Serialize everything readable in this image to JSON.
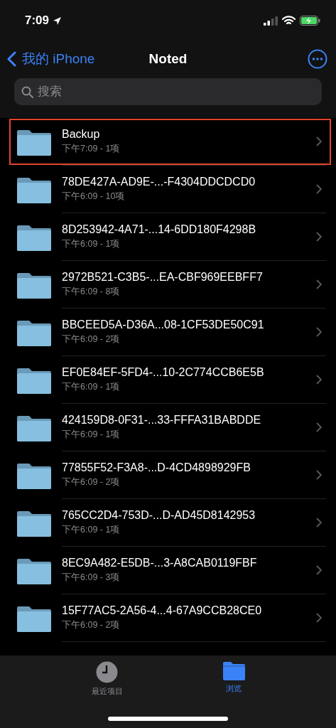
{
  "status_bar": {
    "time": "7:09"
  },
  "nav": {
    "back_label": "我的 iPhone",
    "title": "Noted"
  },
  "search": {
    "placeholder": "搜索"
  },
  "folders": [
    {
      "name": "Backup",
      "meta": "下午7:09 - 1项",
      "highlighted": true
    },
    {
      "name": "78DE427A-AD9E-...-F4304DDCDCD0",
      "meta": "下午6:09 - 10项",
      "highlighted": false
    },
    {
      "name": "8D253942-4A71-...14-6DD180F4298B",
      "meta": "下午6:09 - 1项",
      "highlighted": false
    },
    {
      "name": "2972B521-C3B5-...EA-CBF969EEBFF7",
      "meta": "下午6:09 - 8项",
      "highlighted": false
    },
    {
      "name": "BBCEED5A-D36A...08-1CF53DE50C91",
      "meta": "下午6:09 - 2项",
      "highlighted": false
    },
    {
      "name": "EF0E84EF-5FD4-...10-2C774CCB6E5B",
      "meta": "下午6:09 - 1项",
      "highlighted": false
    },
    {
      "name": "424159D8-0F31-...33-FFFA31BABDDE",
      "meta": "下午6:09 - 1项",
      "highlighted": false
    },
    {
      "name": "77855F52-F3A8-...D-4CD4898929FB",
      "meta": "下午6:09 - 2项",
      "highlighted": false
    },
    {
      "name": "765CC2D4-753D-...D-AD45D8142953",
      "meta": "下午6:09 - 1项",
      "highlighted": false
    },
    {
      "name": "8EC9A482-E5DB-...3-A8CAB0119FBF",
      "meta": "下午6:09 - 3项",
      "highlighted": false
    },
    {
      "name": "15F77AC5-2A56-4...4-67A9CCB28CE0",
      "meta": "下午6:09 - 2项",
      "highlighted": false
    }
  ],
  "tabs": [
    {
      "label": "最近项目",
      "kind": "recents",
      "selected": false
    },
    {
      "label": "浏览",
      "kind": "browse",
      "selected": true
    }
  ]
}
